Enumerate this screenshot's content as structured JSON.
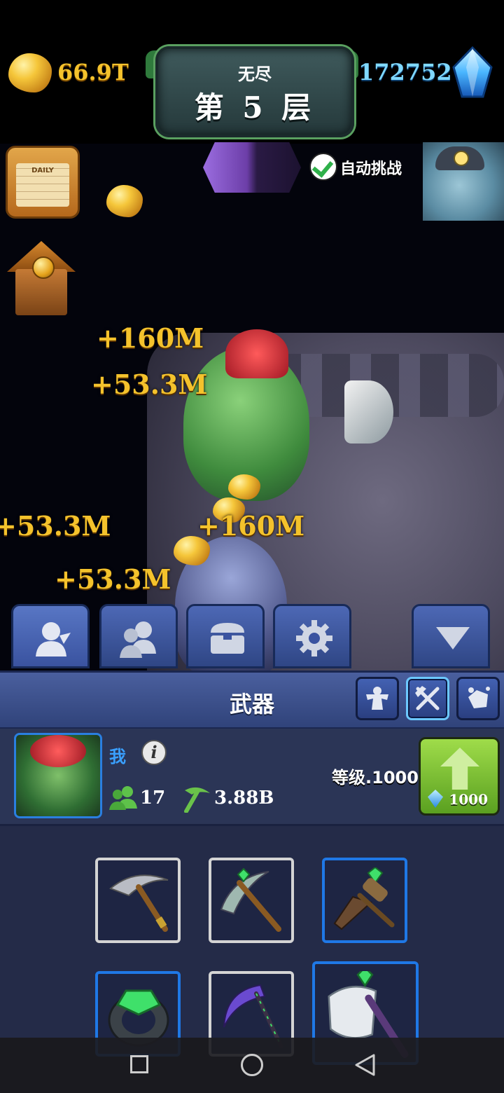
{
  "top_bar": {
    "gold_amount": "66.9T",
    "gem_amount": "172752",
    "mode": "无尽",
    "floor": "第 5 层"
  },
  "hud": {
    "calendar_label": "DAILY",
    "auto_challenge_label": "自动挑战",
    "auto_challenge_checked": true
  },
  "damage_popups": [
    {
      "text": "+160M"
    },
    {
      "text": "+53.3M"
    },
    {
      "text": "+53.3M"
    },
    {
      "text": "+160M"
    },
    {
      "text": "+53.3M"
    }
  ],
  "menu_tabs": [
    {
      "name": "hero",
      "icon": "person-icon"
    },
    {
      "name": "companions",
      "icon": "group-icon"
    },
    {
      "name": "chest",
      "icon": "chest-icon"
    },
    {
      "name": "settings",
      "icon": "gear-icon"
    },
    {
      "name": "collapse",
      "icon": "triangle-down-icon"
    }
  ],
  "panel": {
    "title": "武器",
    "tabs": [
      {
        "name": "strength",
        "icon": "muscle-icon"
      },
      {
        "name": "weapons",
        "icon": "crossed-tools-icon",
        "active": true
      },
      {
        "name": "ores",
        "icon": "ore-icon"
      }
    ]
  },
  "player": {
    "name": "我",
    "info_symbol": "i",
    "followers": "17",
    "mining_power": "3.88B",
    "level_text": "等级.1000",
    "upgrade_cost": "1000"
  },
  "weapons": [
    {
      "name": "iron-pickaxe",
      "border": "grey"
    },
    {
      "name": "emerald-pickaxe",
      "border": "grey"
    },
    {
      "name": "emerald-drill",
      "border": "blue"
    },
    {
      "name": "emerald-ring",
      "border": "blue"
    },
    {
      "name": "shadow-scythe",
      "border": "grey"
    },
    {
      "name": "emerald-axe",
      "border": "blue"
    }
  ],
  "colors": {
    "gold": "#f4c22c",
    "gem": "#7fd8ff",
    "panel_blue": "#30437a",
    "upgrade_green": "#6fb82a",
    "highlight_blue": "#1f78e6"
  }
}
